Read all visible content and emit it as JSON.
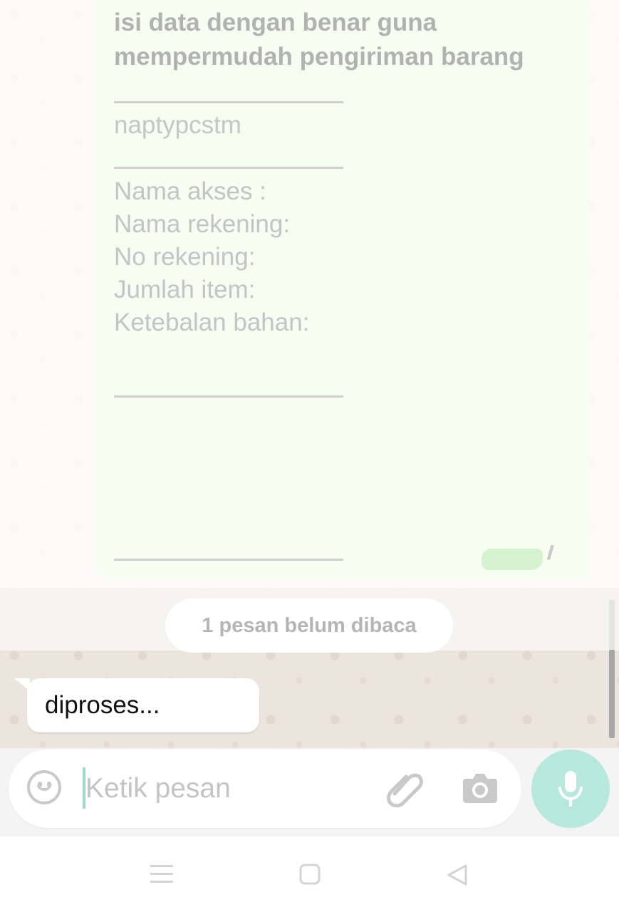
{
  "chat": {
    "outgoing": {
      "line1": "isi data dengan benar guna",
      "line2": "mempermudah pengiriman barang",
      "code": "naptypcstm",
      "fields": [
        "Nama akses :",
        "Nama rekening:",
        "No rekening:",
        "Jumlah item:",
        "Ketebalan bahan:"
      ]
    },
    "unread_banner": "1 pesan belum dibaca",
    "incoming": {
      "text": "diproses..."
    }
  },
  "compose": {
    "placeholder": "Ketik pesan",
    "icons": [
      "emoji-icon",
      "attach-icon",
      "camera-icon",
      "mic-icon"
    ]
  },
  "navbar": {
    "icons": [
      "menu-icon",
      "home-icon",
      "back-icon"
    ]
  },
  "colors": {
    "chat_bg": "#ece5dd",
    "outgoing_bubble": "#f6fdf1",
    "mic_button": "#b7e8dd"
  }
}
